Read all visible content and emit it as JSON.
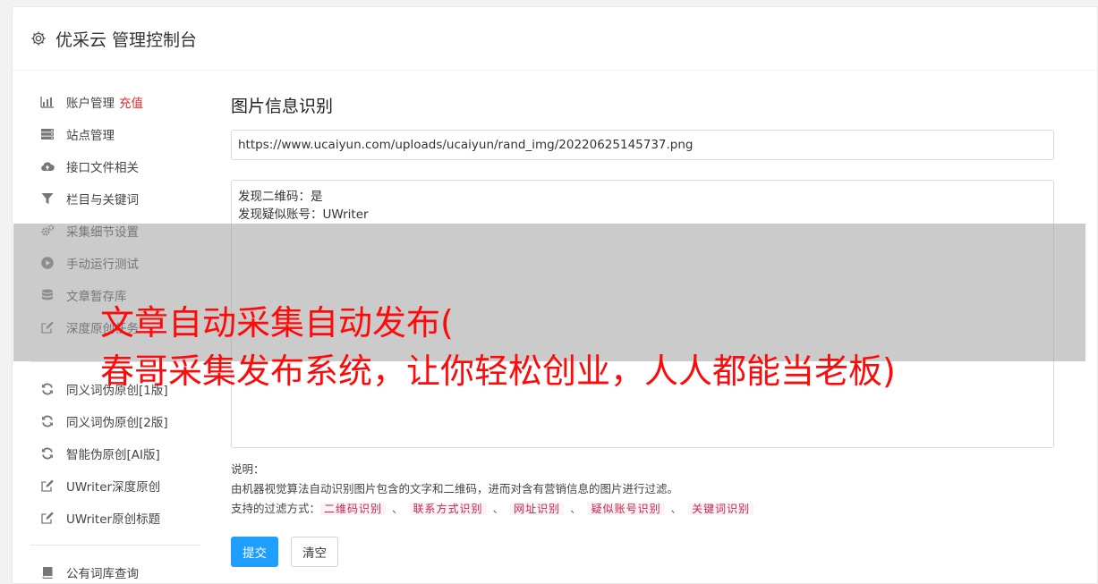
{
  "header": {
    "title": "优采云 管理控制台",
    "icon": "gear-icon"
  },
  "sidebar": {
    "group1": [
      {
        "label": "账户管理",
        "extra": "充值",
        "icon": "bar-chart-icon"
      },
      {
        "label": "站点管理",
        "icon": "server-icon"
      },
      {
        "label": "接口文件相关",
        "icon": "cloud-upload-icon"
      },
      {
        "label": "栏目与关键词",
        "icon": "filter-icon"
      },
      {
        "label": "采集细节设置",
        "icon": "gears-icon"
      },
      {
        "label": "手动运行测试",
        "icon": "play-icon"
      },
      {
        "label": "文章暂存库",
        "icon": "database-icon"
      },
      {
        "label": "深度原创任务",
        "icon": "edit-icon"
      }
    ],
    "group2": [
      {
        "label": "同义词伪原创[1版]",
        "icon": "refresh-icon"
      },
      {
        "label": "同义词伪原创[2版]",
        "icon": "refresh-icon"
      },
      {
        "label": "智能伪原创[AI版]",
        "icon": "refresh-icon"
      },
      {
        "label": "UWriter深度原创",
        "icon": "edit-icon"
      },
      {
        "label": "UWriter原创标题",
        "icon": "edit-icon"
      }
    ],
    "group3": [
      {
        "label": "公有词库查询",
        "icon": "book-icon"
      }
    ]
  },
  "main": {
    "title": "图片信息识别",
    "url_value": "https://www.ucaiyun.com/uploads/ucaiyun/rand_img/20220625145737.png",
    "result_lines": [
      "发现二维码：是",
      "发现疑似账号：UWriter"
    ],
    "desc_label": "说明：",
    "desc_text": "由机器视觉算法自动识别图片包含的文字和二维码，进而对含有营销信息的图片进行过滤。",
    "filter_label": "支持的过滤方式：",
    "filter_tags": [
      "二维码识别",
      "联系方式识别",
      "网址识别",
      "疑似账号识别",
      "关键词识别"
    ],
    "filter_sep": "、",
    "submit_label": "提交",
    "clear_label": "清空"
  },
  "overlay": {
    "line1": "文章自动采集自动发布(",
    "line2": "春哥采集发布系统，让你轻松创业，人人都能当老板)",
    "color": "#ff0a0a"
  },
  "colors": {
    "primary": "#1e9fff",
    "danger": "#e12b2b",
    "tag_text": "#c7254e"
  }
}
